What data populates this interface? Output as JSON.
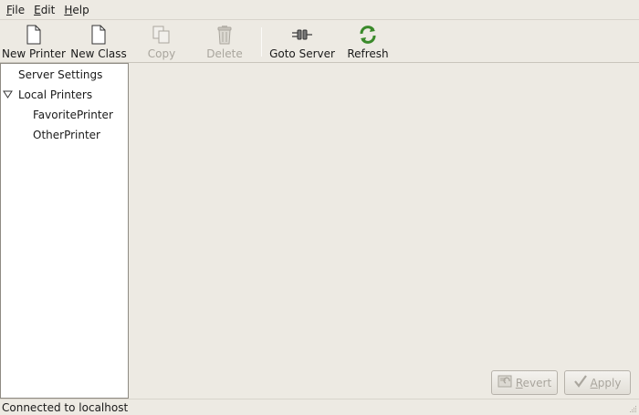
{
  "menubar": {
    "items": [
      {
        "mnemonic": "F",
        "rest": "ile"
      },
      {
        "mnemonic": "E",
        "rest": "dit"
      },
      {
        "mnemonic": "H",
        "rest": "elp"
      }
    ]
  },
  "toolbar": {
    "new_printer": {
      "label": "New Printer",
      "icon": "new-document-icon",
      "enabled": true
    },
    "new_class": {
      "label": "New Class",
      "icon": "new-document-icon",
      "enabled": true
    },
    "copy": {
      "label": "Copy",
      "icon": "copy-icon",
      "enabled": false
    },
    "delete": {
      "label": "Delete",
      "icon": "trash-icon",
      "enabled": false
    },
    "goto_server": {
      "label": "Goto Server",
      "icon": "connect-icon",
      "enabled": true
    },
    "refresh": {
      "label": "Refresh",
      "icon": "refresh-icon",
      "enabled": true
    }
  },
  "tree": {
    "server_settings": "Server Settings",
    "local_printers": {
      "label": "Local Printers",
      "expanded": true
    },
    "printers": [
      "FavoritePrinter",
      "OtherPrinter"
    ]
  },
  "buttons": {
    "revert": {
      "mnemonic": "R",
      "rest": "evert",
      "enabled": false
    },
    "apply": {
      "mnemonic": "A",
      "rest": "pply",
      "enabled": false
    }
  },
  "statusbar": {
    "text": "Connected to localhost"
  },
  "colors": {
    "window_bg": "#edeae3",
    "tree_bg": "#ffffff",
    "disabled_text": "#a9a59d",
    "refresh_green": "#3a8a2a"
  }
}
